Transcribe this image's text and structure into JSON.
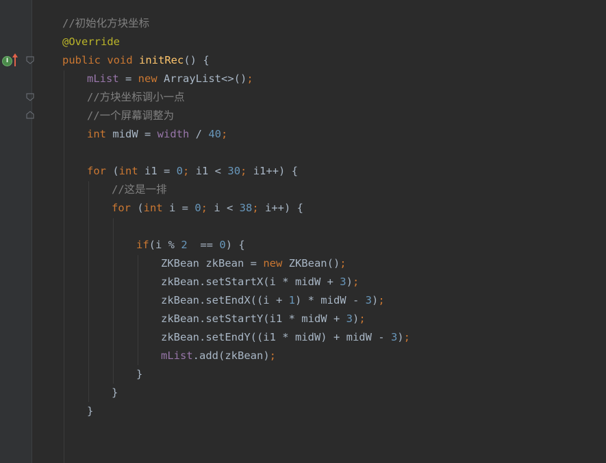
{
  "editor": {
    "lines": [
      [
        {
          "t": "//初始化方块坐标",
          "c": "comment"
        }
      ],
      [
        {
          "t": "@Override",
          "c": "anno"
        }
      ],
      [
        {
          "t": "public ",
          "c": "kw"
        },
        {
          "t": "void ",
          "c": "kw"
        },
        {
          "t": "initRec",
          "c": "fn"
        },
        {
          "t": "() {",
          "c": "plain"
        }
      ],
      [
        {
          "t": "mList",
          "c": "field"
        },
        {
          "t": " = ",
          "c": "plain"
        },
        {
          "t": "new ",
          "c": "kw"
        },
        {
          "t": "ArrayList<>()",
          "c": "plain"
        },
        {
          "t": ";",
          "c": "kw"
        }
      ],
      [
        {
          "t": "//方块坐标调小一点",
          "c": "comment"
        }
      ],
      [
        {
          "t": "//一个屏幕调整为",
          "c": "comment"
        }
      ],
      [
        {
          "t": "int ",
          "c": "kw"
        },
        {
          "t": "midW = ",
          "c": "plain"
        },
        {
          "t": "width",
          "c": "field"
        },
        {
          "t": " / ",
          "c": "plain"
        },
        {
          "t": "40",
          "c": "num"
        },
        {
          "t": ";",
          "c": "kw"
        }
      ],
      [],
      [
        {
          "t": "for ",
          "c": "kw"
        },
        {
          "t": "(",
          "c": "plain"
        },
        {
          "t": "int ",
          "c": "kw"
        },
        {
          "t": "i1 = ",
          "c": "plain"
        },
        {
          "t": "0",
          "c": "num"
        },
        {
          "t": "; ",
          "c": "kw"
        },
        {
          "t": "i1 < ",
          "c": "plain"
        },
        {
          "t": "30",
          "c": "num"
        },
        {
          "t": "; ",
          "c": "kw"
        },
        {
          "t": "i1++) {",
          "c": "plain"
        }
      ],
      [
        {
          "t": "//这是一排",
          "c": "comment"
        }
      ],
      [
        {
          "t": "for ",
          "c": "kw"
        },
        {
          "t": "(",
          "c": "plain"
        },
        {
          "t": "int ",
          "c": "kw"
        },
        {
          "t": "i = ",
          "c": "plain"
        },
        {
          "t": "0",
          "c": "num"
        },
        {
          "t": "; ",
          "c": "kw"
        },
        {
          "t": "i < ",
          "c": "plain"
        },
        {
          "t": "38",
          "c": "num"
        },
        {
          "t": "; ",
          "c": "kw"
        },
        {
          "t": "i++) {",
          "c": "plain"
        }
      ],
      [],
      [
        {
          "t": "if",
          "c": "kw"
        },
        {
          "t": "(i % ",
          "c": "plain"
        },
        {
          "t": "2",
          "c": "num"
        },
        {
          "t": "  == ",
          "c": "plain"
        },
        {
          "t": "0",
          "c": "num"
        },
        {
          "t": ") {",
          "c": "plain"
        }
      ],
      [
        {
          "t": "ZKBean zkBean = ",
          "c": "plain"
        },
        {
          "t": "new ",
          "c": "kw"
        },
        {
          "t": "ZKBean()",
          "c": "plain"
        },
        {
          "t": ";",
          "c": "kw"
        }
      ],
      [
        {
          "t": "zkBean.setStartX(i * midW + ",
          "c": "plain"
        },
        {
          "t": "3",
          "c": "num"
        },
        {
          "t": ")",
          "c": "plain"
        },
        {
          "t": ";",
          "c": "kw"
        }
      ],
      [
        {
          "t": "zkBean.setEndX((i + ",
          "c": "plain"
        },
        {
          "t": "1",
          "c": "num"
        },
        {
          "t": ") * midW - ",
          "c": "plain"
        },
        {
          "t": "3",
          "c": "num"
        },
        {
          "t": ")",
          "c": "plain"
        },
        {
          "t": ";",
          "c": "kw"
        }
      ],
      [
        {
          "t": "zkBean.setStartY(i1 * midW + ",
          "c": "plain"
        },
        {
          "t": "3",
          "c": "num"
        },
        {
          "t": ")",
          "c": "plain"
        },
        {
          "t": ";",
          "c": "kw"
        }
      ],
      [
        {
          "t": "zkBean.setEndY((i1 * midW) + midW - ",
          "c": "plain"
        },
        {
          "t": "3",
          "c": "num"
        },
        {
          "t": ")",
          "c": "plain"
        },
        {
          "t": ";",
          "c": "kw"
        }
      ],
      [
        {
          "t": "mList",
          "c": "field"
        },
        {
          "t": ".add(zkBean)",
          "c": "plain"
        },
        {
          "t": ";",
          "c": "kw"
        }
      ],
      [
        {
          "t": "}",
          "c": "plain"
        }
      ],
      [
        {
          "t": "}",
          "c": "plain"
        }
      ],
      [
        {
          "t": "}",
          "c": "plain"
        }
      ]
    ],
    "indents": [
      0,
      0,
      0,
      1,
      1,
      1,
      1,
      0,
      1,
      2,
      2,
      0,
      3,
      4,
      4,
      4,
      4,
      4,
      4,
      3,
      2,
      1
    ],
    "gutter": {
      "implements_icon_label": "I",
      "implements_icon_name": "implements-icon",
      "override_arrow_name": "override-arrow-icon"
    },
    "colors": {
      "background": "#2b2b2b",
      "gutter": "#313335",
      "comment": "#808080",
      "keyword": "#cc7832",
      "number": "#6897bb",
      "field": "#9876aa",
      "function": "#ffc66d",
      "annotation": "#bbb529",
      "plain": "#a9b7c6"
    }
  }
}
